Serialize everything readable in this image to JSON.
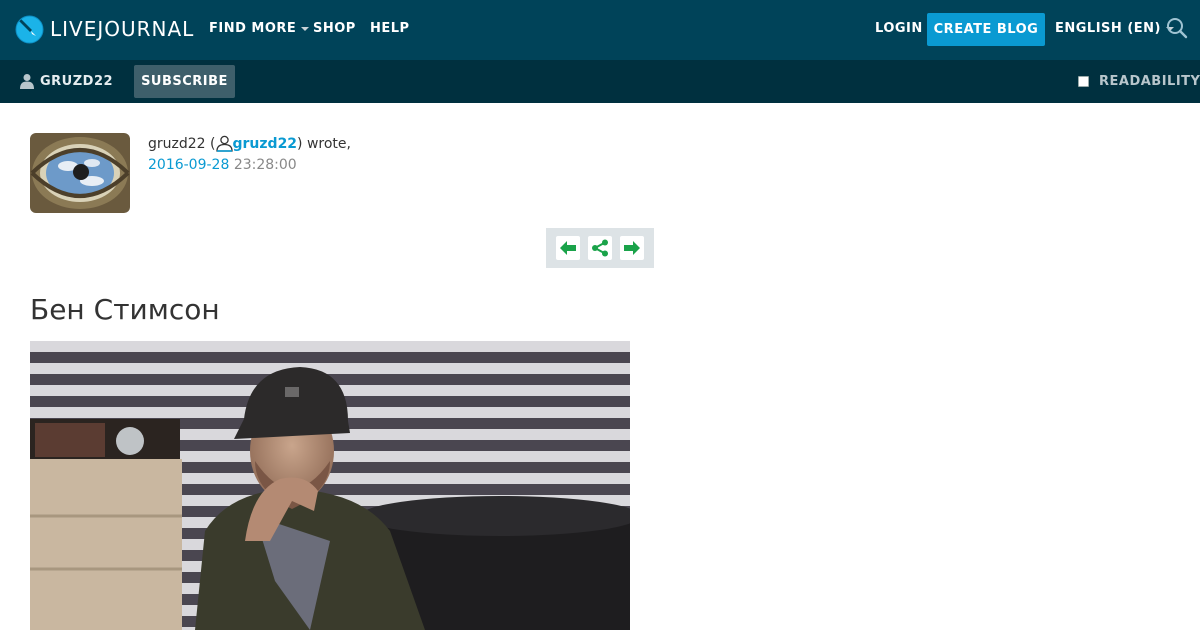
{
  "header": {
    "logo_text": "LIVEJOURNAL",
    "nav": {
      "find_more": "FIND MORE",
      "shop": "SHOP",
      "help": "HELP"
    },
    "login": "LOGIN",
    "create_blog": "CREATE BLOG",
    "language": "ENGLISH (EN)"
  },
  "subheader": {
    "username": "GRUZD22",
    "subscribe": "SUBSCRIBE",
    "readability": "READABILITY"
  },
  "entry": {
    "author_name": "gruzd22",
    "open_paren": " (",
    "author_link": "gruzd22",
    "wrote": ") wrote,",
    "date": "2016-09-28",
    "time": " 23:28:00",
    "title": "Бен Стимсон"
  },
  "colors": {
    "header_bg": "#004359",
    "subheader_bg": "#00303f",
    "accent": "#0a9ad2",
    "nav_arrow": "#1aa34a"
  },
  "icons": {
    "logo": "livejournal-logo-icon",
    "search": "search-icon",
    "user": "user-icon",
    "prev": "arrow-left-icon",
    "share": "share-icon",
    "next": "arrow-right-icon"
  }
}
